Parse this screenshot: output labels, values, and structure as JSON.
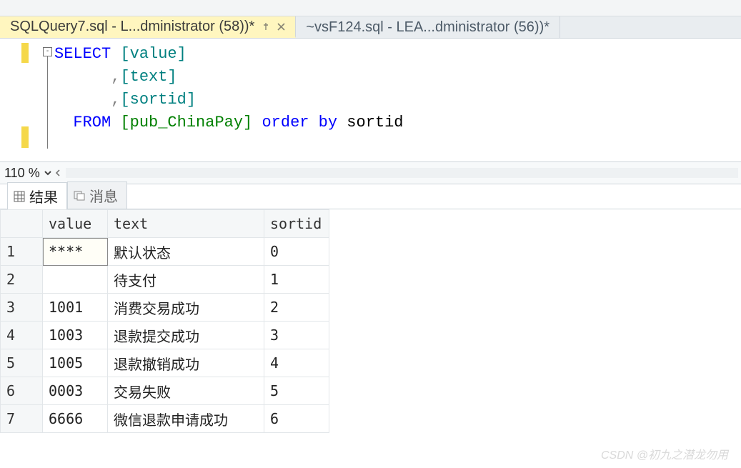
{
  "tabs": {
    "items": [
      {
        "label": "SQLQuery7.sql - L...dministrator (58))*",
        "active": true,
        "pinned": true,
        "closable": true
      },
      {
        "label": "~vsF124.sql - LEA...dministrator (56))*",
        "active": false,
        "pinned": false,
        "closable": false
      }
    ]
  },
  "editor": {
    "collapse_glyph": "-",
    "lines": [
      {
        "tokens": [
          {
            "t": "SELECT ",
            "cls": "kw-blue"
          },
          {
            "t": "[value]",
            "cls": "brk"
          }
        ]
      },
      {
        "tokens": [
          {
            "t": "      ",
            "cls": "kw-black"
          },
          {
            "t": ",",
            "cls": "kw-gray"
          },
          {
            "t": "[text]",
            "cls": "brk"
          }
        ]
      },
      {
        "tokens": [
          {
            "t": "      ",
            "cls": "kw-black"
          },
          {
            "t": ",",
            "cls": "kw-gray"
          },
          {
            "t": "[sortid]",
            "cls": "brk"
          }
        ]
      },
      {
        "highlight": true,
        "tokens": [
          {
            "t": "  FROM ",
            "cls": "kw-blue"
          },
          {
            "t": "[pub_ChinaPay]",
            "cls": "green-sel"
          },
          {
            "t": " ",
            "cls": "kw-black"
          },
          {
            "t": "order by",
            "cls": "kw-blue"
          },
          {
            "t": " sortid",
            "cls": "kw-black"
          }
        ]
      }
    ]
  },
  "zoom": {
    "value": "110 %"
  },
  "result_tabs": {
    "items": [
      {
        "icon": "grid-icon",
        "label": "结果",
        "active": true
      },
      {
        "icon": "messages-icon",
        "label": "消息",
        "active": false
      }
    ]
  },
  "grid": {
    "columns": [
      "value",
      "text",
      "sortid"
    ],
    "rows": [
      {
        "n": "1",
        "value": "****",
        "text": "默认状态",
        "sortid": "0",
        "sel_col": "value"
      },
      {
        "n": "2",
        "value": "",
        "text": "待支付",
        "sortid": "1"
      },
      {
        "n": "3",
        "value": "1001",
        "text": "消费交易成功",
        "sortid": "2"
      },
      {
        "n": "4",
        "value": "1003",
        "text": "退款提交成功",
        "sortid": "3"
      },
      {
        "n": "5",
        "value": "1005",
        "text": "退款撤销成功",
        "sortid": "4"
      },
      {
        "n": "6",
        "value": "0003",
        "text": "交易失败",
        "sortid": "5"
      },
      {
        "n": "7",
        "value": "6666",
        "text": "微信退款申请成功",
        "sortid": "6"
      }
    ]
  },
  "watermark": "CSDN @初九之潜龙勿用"
}
